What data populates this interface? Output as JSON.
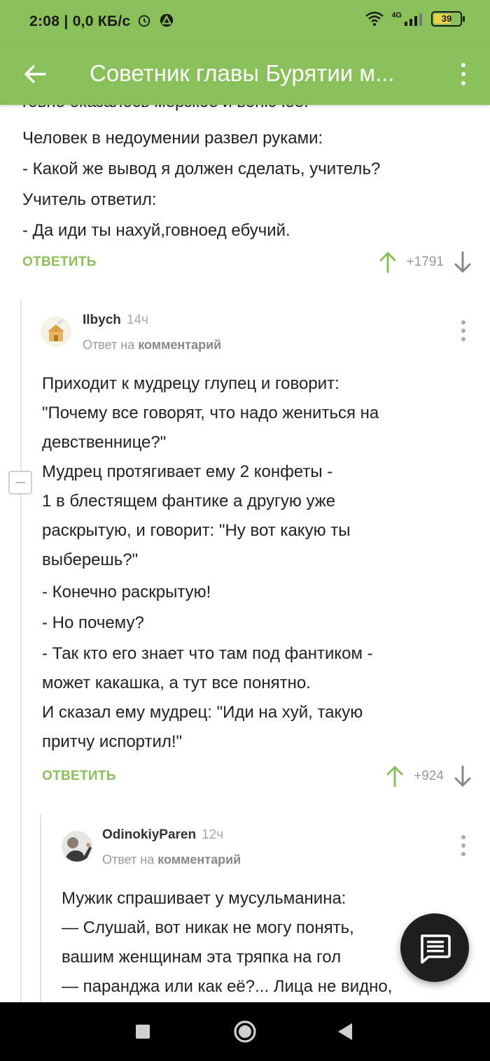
{
  "status_bar": {
    "time": "2:08",
    "speed": "0,0 КБ/с",
    "network": "4G",
    "battery": "39"
  },
  "header": {
    "title": "Советник главы Бурятии м..."
  },
  "post": {
    "cut_line": "говно оказалось мерзкое и вонючее.",
    "lines": [
      "Человек в недоумении развел руками:",
      "- Какой же вывод я должен сделать, учитель?",
      "Учитель ответил:",
      "- Да иди ты нахуй,говноед ебучий."
    ],
    "reply_label": "ОТВЕТИТЬ",
    "rating": "+1791"
  },
  "comment1": {
    "username": "Ilbych",
    "time": "14ч",
    "reply_prefix": "Ответ на",
    "reply_target": "комментарий",
    "lines": [
      "Приходит к мудрецу глупец и говорит:",
      "\"Почему все говорят, что надо жениться на",
      "девственнице?\"",
      "Мудрец протягивает ему 2 конфеты -",
      "1 в блестящем фантике а другую уже",
      "раскрытую, и говорит: \"Ну вот какую ты",
      "выберешь?\"",
      "- Конечно раскрытую!",
      "- Но почему?",
      "- Так кто его знает что там под фантиком -",
      "может какашка, а тут все понятно.",
      "И сказал ему мудрец: \"Иди на хуй, такую",
      "притчу испортил!\""
    ],
    "reply_label": "ОТВЕТИТЬ",
    "rating": "+924"
  },
  "comment2": {
    "username": "OdinokiyParen",
    "time": "12ч",
    "reply_prefix": "Ответ на",
    "reply_target": "комментарий",
    "lines": [
      "Мужик спрашивает у мусульманина:",
      "— Слушай, вот никак не могу понять,",
      "вашим женщинам эта тряпка на гол",
      "— паранджа или как её?... Лица не видно,"
    ]
  },
  "colors": {
    "accent": "#8ac05a",
    "fab": "#1f1f1f"
  }
}
